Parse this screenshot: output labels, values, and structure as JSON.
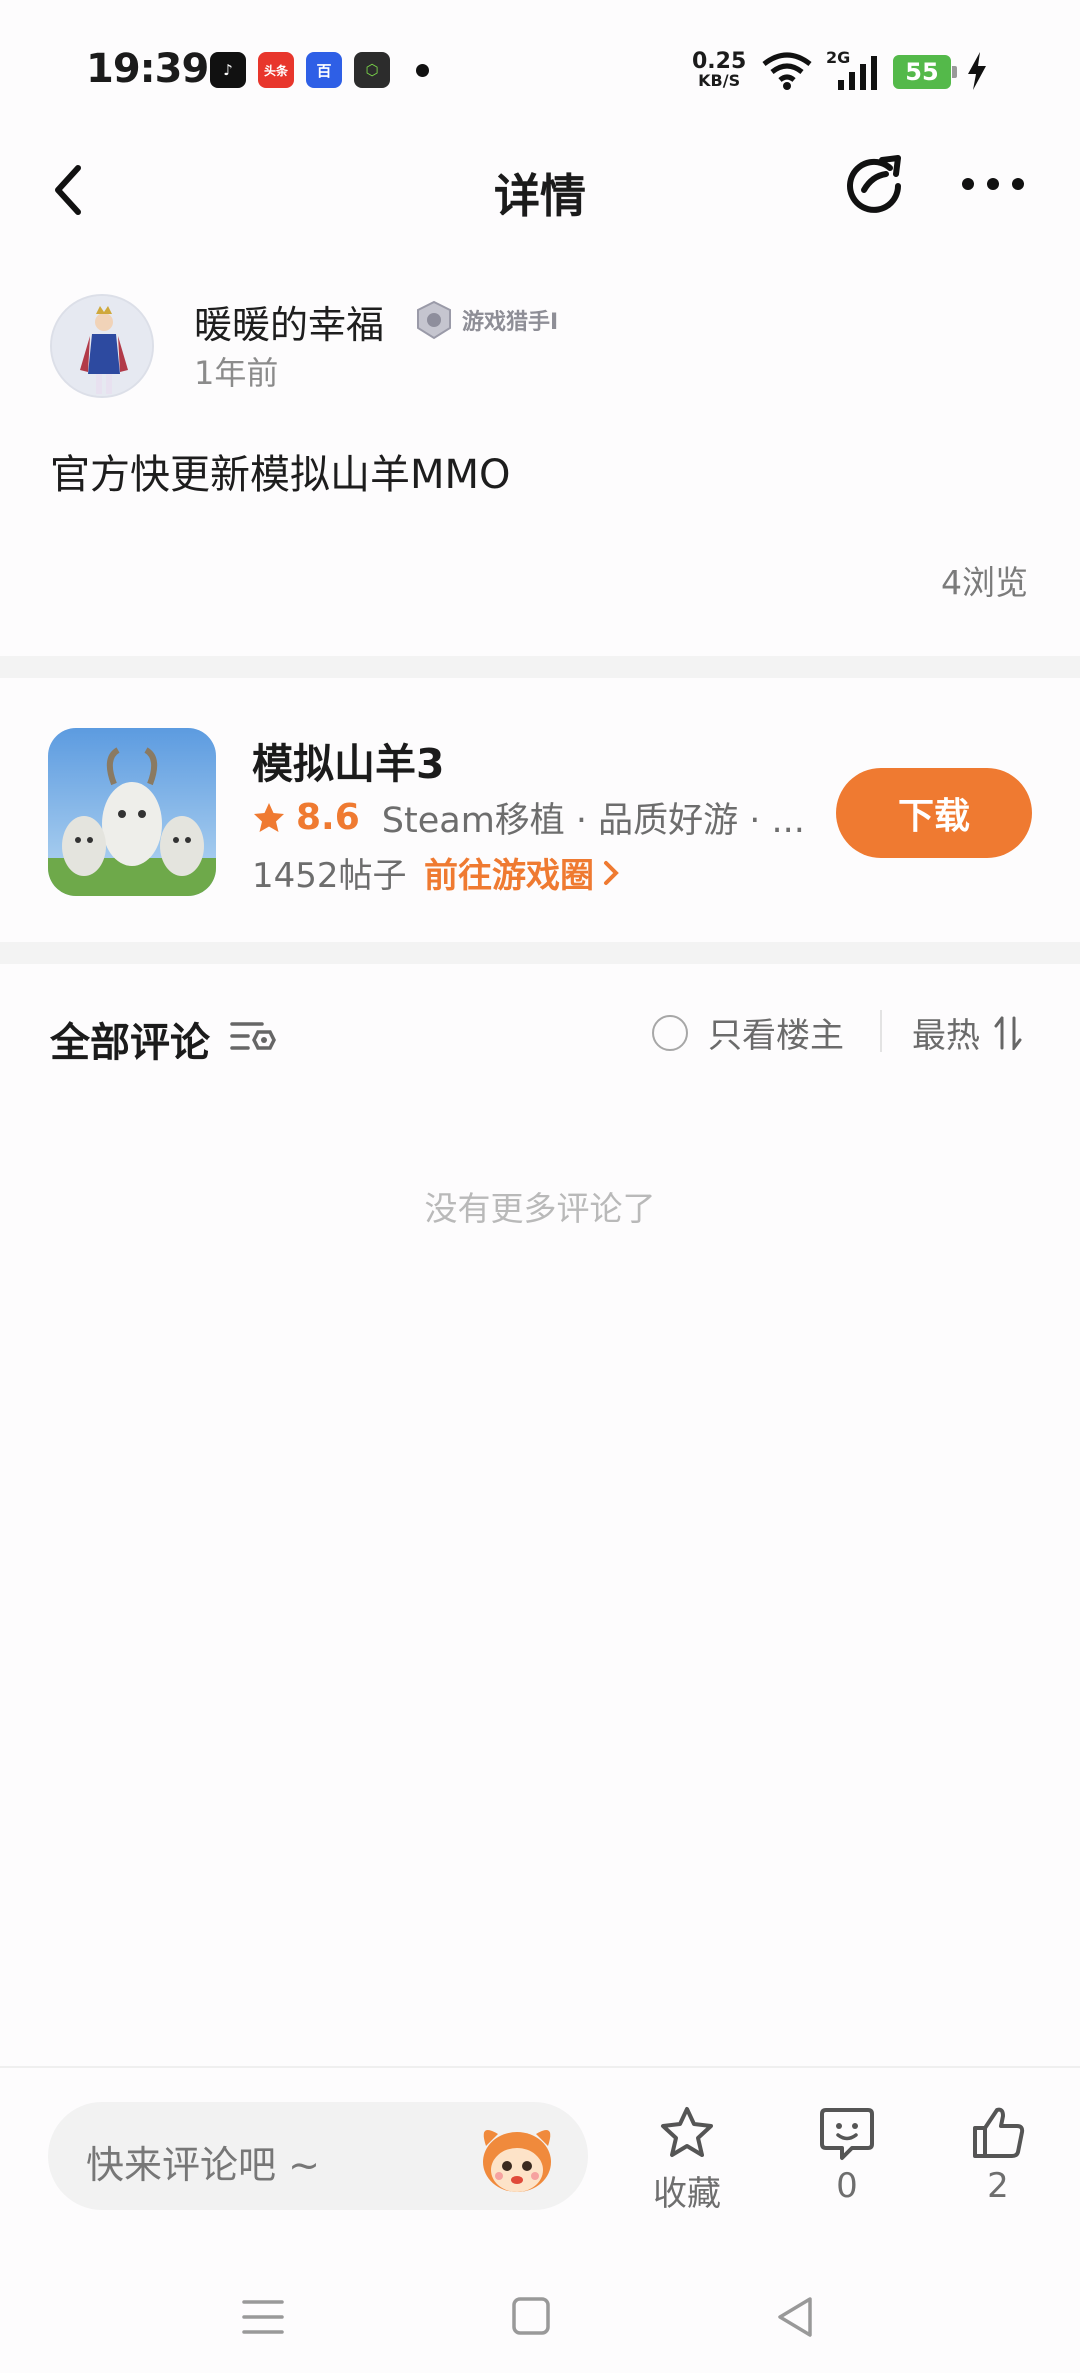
{
  "status_bar": {
    "time": "19:39",
    "app_icons": [
      {
        "name": "tiktok-icon",
        "color": "#111111",
        "label": "♪"
      },
      {
        "name": "toutiao-icon",
        "color": "#e8362c",
        "label": "头条"
      },
      {
        "name": "baidu-icon",
        "color": "#2e5fe6",
        "label": "百"
      },
      {
        "name": "game-box-icon",
        "color": "#2c2c2c",
        "label": "⬡"
      }
    ],
    "net_speed_value": "0.25",
    "net_speed_unit": "KB/S",
    "network": "2G",
    "battery": "55"
  },
  "header": {
    "title": "详情"
  },
  "author": {
    "name": "暖暖的幸福",
    "badge": "游戏猎手I",
    "time": "1年前"
  },
  "post": {
    "text": "官方快更新模拟山羊MMO",
    "views": "4浏览"
  },
  "game": {
    "title": "模拟山羊3",
    "rating": "8.6",
    "tags": "Steam移植 · 品质好游 · ...",
    "posts": "1452帖子",
    "link": "前往游戏圈",
    "download": "下载"
  },
  "comments": {
    "title": "全部评论",
    "only_owner": "只看楼主",
    "sort": "最热",
    "empty": "没有更多评论了"
  },
  "bottom_bar": {
    "input_placeholder": "快来评论吧 ~",
    "favorite_label": "收藏",
    "comment_count": "0",
    "like_count": "2"
  },
  "colors": {
    "accent": "#ef7a31",
    "battery": "#54b94a"
  }
}
